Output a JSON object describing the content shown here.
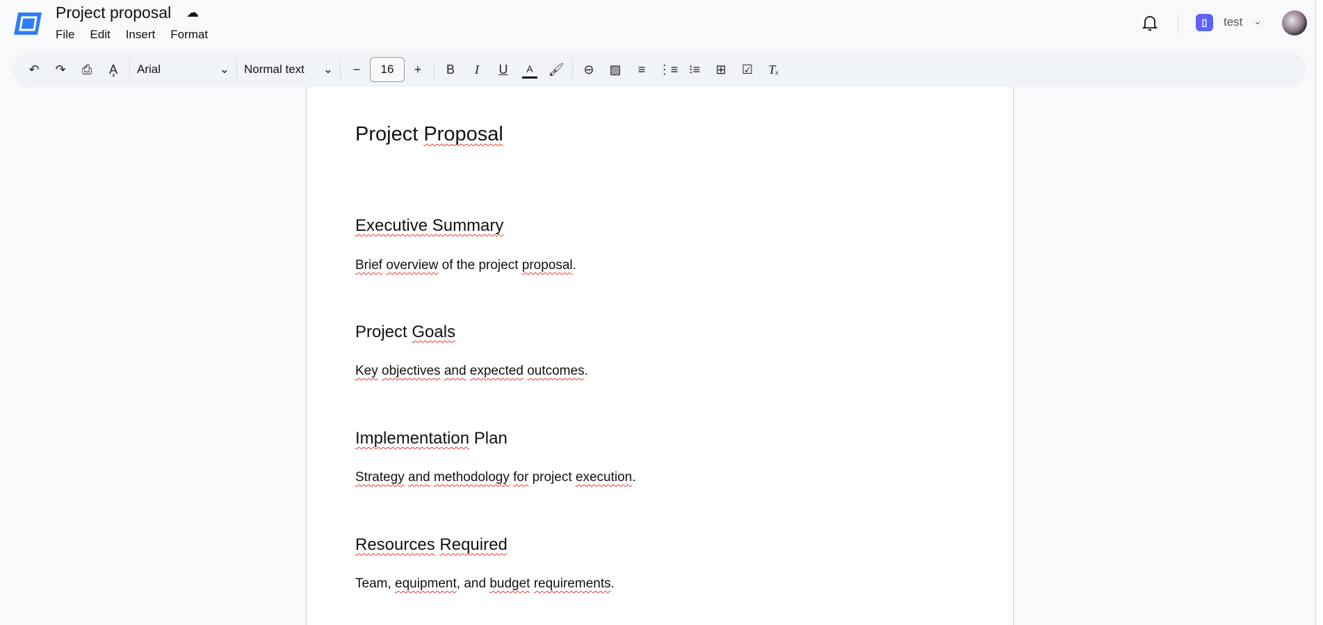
{
  "header": {
    "title": "Project proposal",
    "menus": [
      "File",
      "Edit",
      "Insert",
      "Format"
    ],
    "org_name": "test",
    "org_initial": "▌"
  },
  "toolbar": {
    "font": "Arial",
    "style": "Normal text",
    "font_size": "16",
    "icons": [
      "undo-icon",
      "redo-icon",
      "print-icon",
      "spellcheck-icon",
      "decrease-size-icon",
      "increase-size-icon",
      "bold-icon",
      "italic-icon",
      "underline-icon",
      "text-color-icon",
      "highlight-icon",
      "link-icon",
      "image-icon",
      "align-icon",
      "numbered-list-icon",
      "bulleted-list-icon",
      "comment-icon",
      "checklist-icon",
      "clear-formatting-icon"
    ]
  },
  "document": {
    "title": [
      "Project ",
      "Proposal"
    ],
    "sections": [
      {
        "heading": [
          "Executive ",
          "Summary"
        ],
        "body": [
          "Brief",
          " ",
          "overview",
          " of the project ",
          "proposal",
          "."
        ]
      },
      {
        "heading": [
          "Project ",
          "Goals"
        ],
        "body": [
          "Key",
          " ",
          "objectives",
          " ",
          "and",
          " ",
          "expected",
          " ",
          "outcomes",
          "."
        ]
      },
      {
        "heading": [
          "Implementation",
          " Plan"
        ],
        "body": [
          "Strategy",
          " ",
          "and",
          " ",
          "methodology",
          " ",
          "for",
          " project ",
          "execution",
          "."
        ]
      },
      {
        "heading": [
          "Resources",
          " ",
          "Required"
        ],
        "body": [
          "Team, ",
          "equipment",
          ", and ",
          "budget",
          " ",
          "requirements",
          "."
        ]
      }
    ]
  }
}
